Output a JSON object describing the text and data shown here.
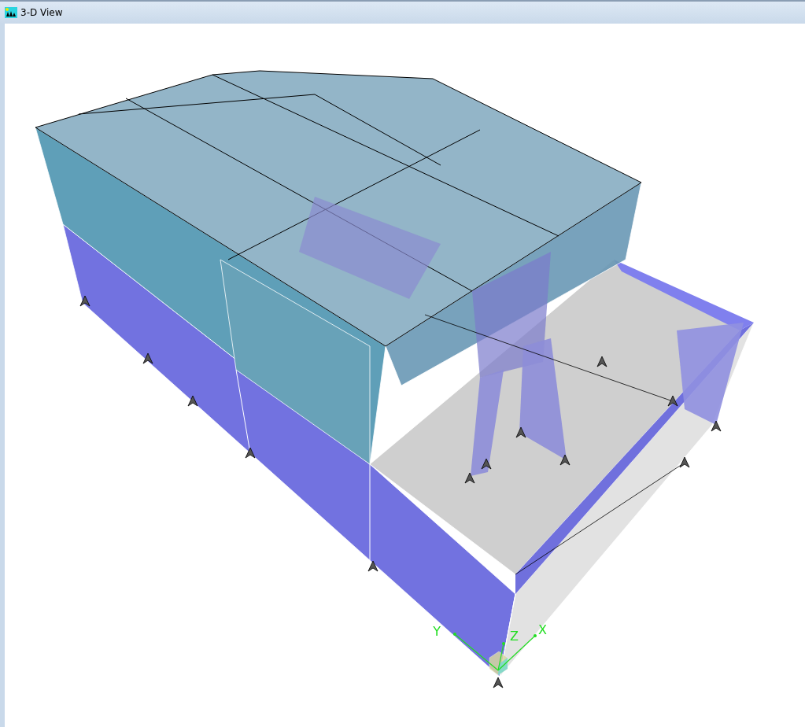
{
  "window": {
    "title": "3-D View"
  },
  "axes": [
    {
      "kind": "y",
      "label": "Y"
    },
    {
      "kind": "z",
      "label": "Z"
    },
    {
      "kind": "x",
      "label": "X"
    }
  ]
}
